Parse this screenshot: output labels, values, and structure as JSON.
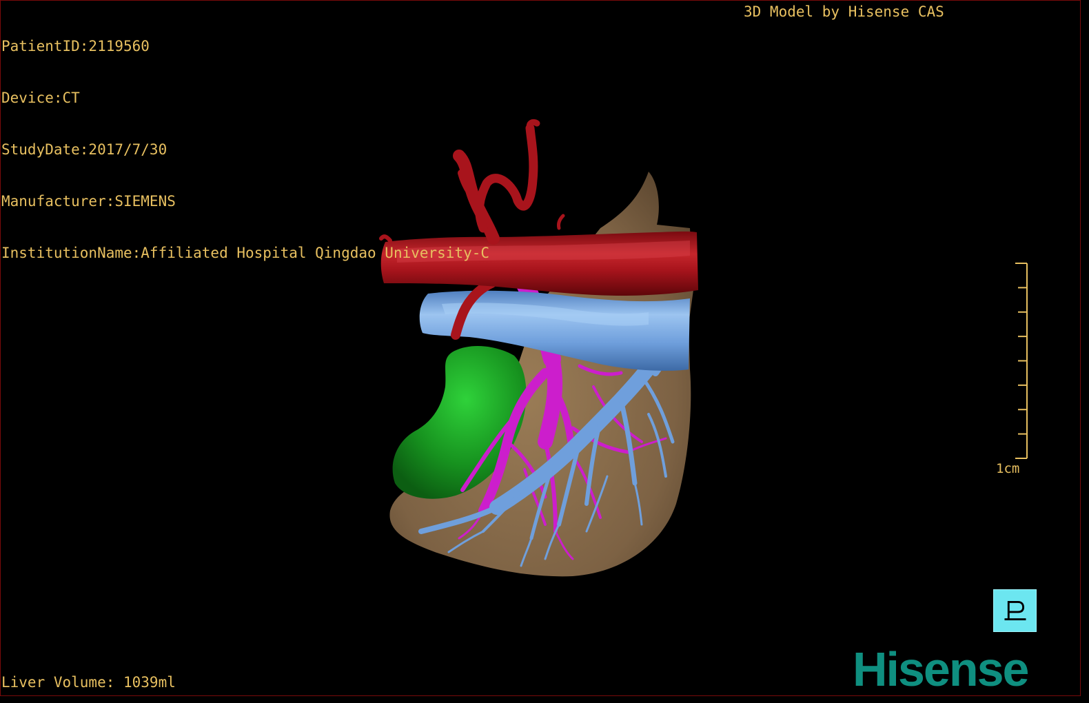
{
  "overlay": {
    "patient_lines": [
      "PatientID:2119560",
      "Device:CT",
      "StudyDate:2017/7/30",
      "Manufacturer:SIEMENS",
      "InstitutionName:Affiliated Hospital Qingdao University-C"
    ],
    "model_credit": "3D Model by Hisense CAS",
    "liver_volume": "Liver Volume: 1039ml"
  },
  "scale_bar": {
    "label": "1cm",
    "tick_count": 9
  },
  "orientation_cube": {
    "letter": "P",
    "icon": "orientation-cube-icon"
  },
  "brand": {
    "name": "Hisense"
  },
  "structures": [
    {
      "name": "liver-parenchyma",
      "color": "#8a6e4b"
    },
    {
      "name": "hepatic-artery-aorta",
      "color": "#a8141c"
    },
    {
      "name": "vena-cava-hepatic-veins",
      "color": "#6f9fdc"
    },
    {
      "name": "portal-vein",
      "color": "#cc1ecc"
    },
    {
      "name": "gallbladder",
      "color": "#1a9a20"
    }
  ],
  "colors": {
    "overlay_text": "#e8c060",
    "brand": "#0f8f80",
    "cube": "#6ce6f0",
    "frame": "#7a0a0a"
  }
}
